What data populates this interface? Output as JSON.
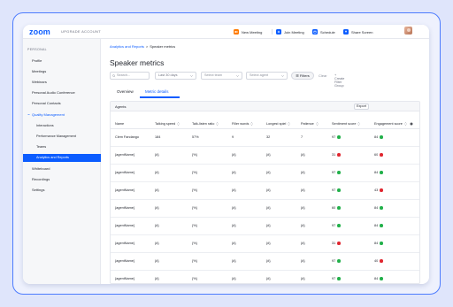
{
  "app": {
    "logo": "zoom",
    "upgrade_label": "UPGRADE ACCOUNT",
    "colors": {
      "accent": "#0b5cff",
      "good": "#22b04a",
      "bad": "#e0262f",
      "orange": "#ff7a00"
    }
  },
  "topbar": {
    "actions": [
      {
        "label": "New Meeting",
        "icon": "video-icon",
        "color": "#ff7a00"
      },
      {
        "label": "Join Meeting",
        "icon": "plus-icon",
        "color": "#0b5cff"
      },
      {
        "label": "Schedule",
        "icon": "calendar-icon",
        "color": "#0b5cff"
      },
      {
        "label": "Share Screen",
        "icon": "share-icon",
        "color": "#0b5cff"
      }
    ]
  },
  "sidebar": {
    "section": "PERSONAL",
    "items": [
      {
        "label": "Profile"
      },
      {
        "label": "Meetings"
      },
      {
        "label": "Webinars"
      },
      {
        "label": "Personal Audio Conference"
      },
      {
        "label": "Personal Contacts"
      },
      {
        "label": "Quality Management"
      },
      {
        "label": "Interactions"
      },
      {
        "label": "Performance Management"
      },
      {
        "label": "Teams"
      },
      {
        "label": "Analytics and Reports"
      },
      {
        "label": "Whiteboard"
      },
      {
        "label": "Recordings"
      },
      {
        "label": "Settings"
      }
    ]
  },
  "breadcrumb": {
    "parent": "Analytics and Reports",
    "separator": ">",
    "current": "Speaker metrics"
  },
  "page": {
    "title": "Speaker metrics"
  },
  "filters": {
    "search_placeholder": "Search...",
    "date_range": "Last 30 days",
    "team_placeholder": "Select team",
    "agent_placeholder": "Select agent",
    "filters_label": "Filters",
    "clear_label": "Clear",
    "create_group_label": "+ Create Filter Group"
  },
  "tabs": {
    "overview": "Overview",
    "metric_details": "Metric details"
  },
  "table": {
    "section_label": "Agents",
    "export_label": "Export",
    "columns": [
      "Name",
      "Talking speed",
      "Talk-listen ratio",
      "Filler words",
      "Longest spiel",
      "Patience",
      "Sentiment score",
      "Engagement score"
    ],
    "rows": [
      {
        "name": "Clem Fandango",
        "speed": "184",
        "ratio": "57%",
        "filler": "9",
        "spiel": "32",
        "patience": "7",
        "sentiment": "97",
        "sentiment_status": "good",
        "engagement": "84",
        "engagement_status": "good"
      },
      {
        "name": "{agentName}",
        "speed": "{#}",
        "ratio": "{%}",
        "filler": "{#}",
        "spiel": "{#}",
        "patience": "{#}",
        "sentiment": "31",
        "sentiment_status": "bad",
        "engagement": "60",
        "engagement_status": "bad"
      },
      {
        "name": "{agentName}",
        "speed": "{#}",
        "ratio": "{%}",
        "filler": "{#}",
        "spiel": "{#}",
        "patience": "{#}",
        "sentiment": "97",
        "sentiment_status": "good",
        "engagement": "84",
        "engagement_status": "good"
      },
      {
        "name": "{agentName}",
        "speed": "{#}",
        "ratio": "{%}",
        "filler": "{#}",
        "spiel": "{#}",
        "patience": "{#}",
        "sentiment": "97",
        "sentiment_status": "good",
        "engagement": "43",
        "engagement_status": "bad"
      },
      {
        "name": "{agentName}",
        "speed": "{#}",
        "ratio": "{%}",
        "filler": "{#}",
        "spiel": "{#}",
        "patience": "{#}",
        "sentiment": "60",
        "sentiment_status": "good",
        "engagement": "84",
        "engagement_status": "good"
      },
      {
        "name": "{agentName}",
        "speed": "{#}",
        "ratio": "{%}",
        "filler": "{#}",
        "spiel": "{#}",
        "patience": "{#}",
        "sentiment": "97",
        "sentiment_status": "good",
        "engagement": "84",
        "engagement_status": "good"
      },
      {
        "name": "{agentName}",
        "speed": "{#}",
        "ratio": "{%}",
        "filler": "{#}",
        "spiel": "{#}",
        "patience": "{#}",
        "sentiment": "31",
        "sentiment_status": "bad",
        "engagement": "84",
        "engagement_status": "good"
      },
      {
        "name": "{agentName}",
        "speed": "{#}",
        "ratio": "{%}",
        "filler": "{#}",
        "spiel": "{#}",
        "patience": "{#}",
        "sentiment": "97",
        "sentiment_status": "good",
        "engagement": "40",
        "engagement_status": "bad"
      },
      {
        "name": "{agentName}",
        "speed": "{#}",
        "ratio": "{%}",
        "filler": "{#}",
        "spiel": "{#}",
        "patience": "{#}",
        "sentiment": "97",
        "sentiment_status": "good",
        "engagement": "84",
        "engagement_status": "good"
      }
    ]
  }
}
